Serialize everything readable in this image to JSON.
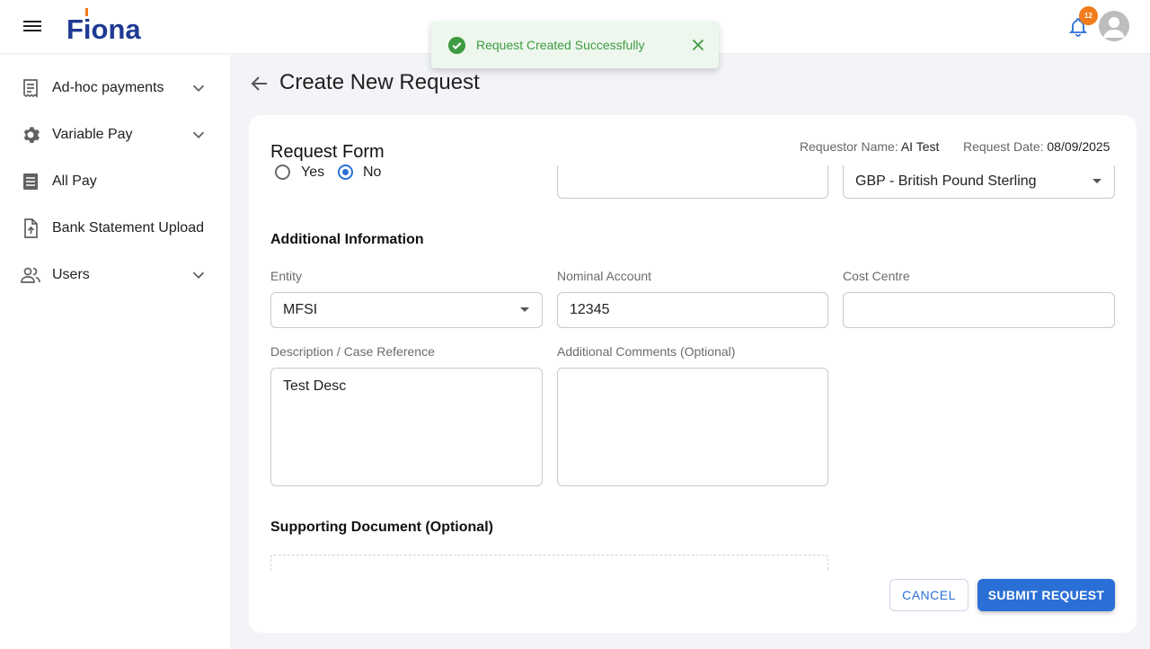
{
  "header": {
    "app_name": "Fiona",
    "notification_count": "12",
    "colors": {
      "brand_blue": "#1f3a93",
      "badge": "#f07c1b"
    }
  },
  "sidebar": {
    "items": [
      {
        "label": "Ad-hoc payments",
        "icon": "receipt-icon",
        "expandable": true
      },
      {
        "label": "Variable Pay",
        "icon": "gear-icon",
        "expandable": true
      },
      {
        "label": "All Pay",
        "icon": "document-list-icon",
        "expandable": false
      },
      {
        "label": "Bank Statement Upload",
        "icon": "file-upload-icon",
        "expandable": false
      },
      {
        "label": "Users",
        "icon": "users-icon",
        "expandable": true
      }
    ]
  },
  "page": {
    "title": "Create New Request"
  },
  "form": {
    "title": "Request Form",
    "requestor_label": "Requestor Name:",
    "requestor_value": "AI Test",
    "date_label": "Request Date:",
    "date_value": "08/09/2025",
    "radio": {
      "yes_label": "Yes",
      "no_label": "No",
      "selected": "No"
    },
    "partial_field_value": "",
    "currency_value": "GBP - British Pound Sterling",
    "additional_info_title": "Additional Information",
    "entity": {
      "label": "Entity",
      "value": "MFSI"
    },
    "nominal_account": {
      "label": "Nominal Account",
      "value": "12345"
    },
    "cost_centre": {
      "label": "Cost Centre",
      "value": ""
    },
    "description": {
      "label": "Description / Case Reference",
      "value": "Test Desc"
    },
    "comments": {
      "label": "Additional Comments (Optional)",
      "value": ""
    },
    "supporting_doc_title": "Supporting Document (Optional)"
  },
  "actions": {
    "cancel_label": "CANCEL",
    "submit_label": "SUBMIT REQUEST",
    "accent": "#2a6fd6"
  },
  "toast": {
    "message": "Request Created Successfully",
    "color": "#3f9b43"
  }
}
